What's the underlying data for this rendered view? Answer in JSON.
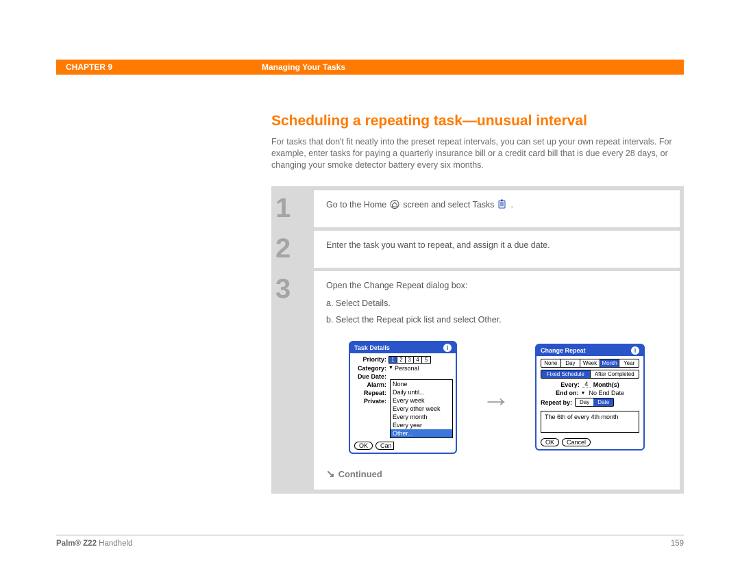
{
  "header": {
    "chapter": "CHAPTER 9",
    "title": "Managing Your Tasks"
  },
  "section": {
    "title": "Scheduling a repeating task—unusual interval",
    "intro": "For tasks that don't fit neatly into the preset repeat intervals, you can set up your own repeat intervals. For example, enter tasks for paying a quarterly insurance bill or a credit card bill that is due every 28 days, or changing your smoke detector battery every six months."
  },
  "steps": [
    {
      "num": "1",
      "text_pre": "Go to the Home ",
      "text_mid": " screen and select Tasks ",
      "text_post": "."
    },
    {
      "num": "2",
      "text": "Enter the task you want to repeat, and assign it a due date."
    },
    {
      "num": "3",
      "text": "Open the Change Repeat dialog box:",
      "sub": [
        "a.  Select Details.",
        "b.  Select the Repeat pick list and select Other."
      ]
    }
  ],
  "continued": "Continued",
  "task_details": {
    "title": "Task Details",
    "rows": {
      "priority_label": "Priority:",
      "priority_values": [
        "1",
        "2",
        "3",
        "4",
        "5"
      ],
      "priority_selected": 0,
      "category_label": "Category:",
      "category_value": "Personal",
      "due_date_label": "Due Date:",
      "alarm_label": "Alarm:",
      "repeat_label": "Repeat:",
      "private_label": "Private:"
    },
    "dropdown": [
      "None",
      "Daily until...",
      "Every week",
      "Every other week",
      "Every month",
      "Every year",
      "Other..."
    ],
    "dropdown_selected": 6,
    "buttons": [
      "OK",
      "Can"
    ]
  },
  "change_repeat": {
    "title": "Change Repeat",
    "tabs1": [
      "None",
      "Day",
      "Week",
      "Month",
      "Year"
    ],
    "tabs1_selected": 3,
    "tabs2": [
      "Fixed Schedule",
      "After Completed"
    ],
    "tabs2_selected": 0,
    "every_label": "Every:",
    "every_value": "4",
    "every_unit": "Month(s)",
    "end_on_label": "End on:",
    "end_on_value": "No End Date",
    "repeat_by_label": "Repeat by:",
    "repeat_by_options": [
      "Day",
      "Date"
    ],
    "repeat_by_selected": 1,
    "summary": "The 6th of every 4th month",
    "buttons": [
      "OK",
      "Cancel"
    ]
  },
  "footer": {
    "product_bold": "Palm® Z22",
    "product_rest": " Handheld",
    "page": "159"
  }
}
